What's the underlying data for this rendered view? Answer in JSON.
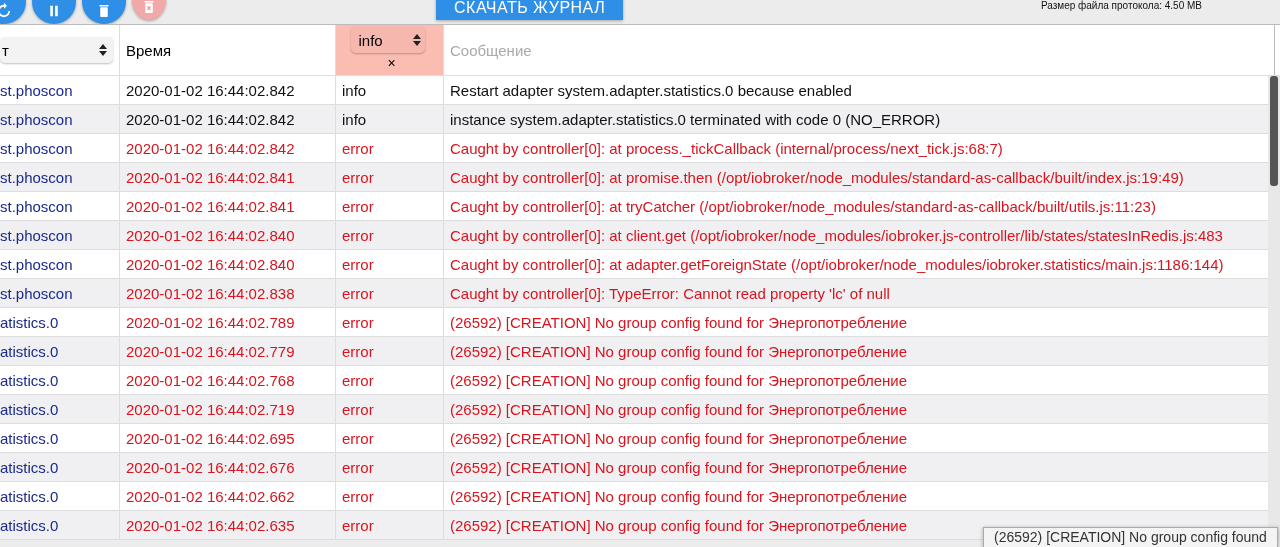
{
  "toolbar": {
    "buttons": [
      {
        "kind": "refresh"
      },
      {
        "kind": "pause"
      },
      {
        "kind": "delete"
      },
      {
        "kind": "clear",
        "disabled": true
      }
    ],
    "download_label": "СКАЧАТЬ ЖУРНАЛ",
    "file_size": "Размер файла протокола: 4.50 MB"
  },
  "table": {
    "columns": [
      {
        "kind": "select",
        "value": "т"
      },
      {
        "kind": "label",
        "label": "Время"
      },
      {
        "kind": "level",
        "value": "info",
        "clear": "×"
      },
      {
        "kind": "search",
        "placeholder": "Сообщение"
      }
    ],
    "rows": [
      {
        "source": "st.phoscon",
        "time": "2020-01-02 16:44:02.842",
        "level": "info",
        "kind": "info",
        "message": "Restart adapter system.adapter.statistics.0 because enabled"
      },
      {
        "source": "st.phoscon",
        "time": "2020-01-02 16:44:02.842",
        "level": "info",
        "kind": "info",
        "message": "instance system.adapter.statistics.0 terminated with code 0 (NO_ERROR)"
      },
      {
        "source": "st.phoscon",
        "time": "2020-01-02 16:44:02.842",
        "level": "error",
        "kind": "error",
        "message": "Caught by controller[0]: at process._tickCallback (internal/process/next_tick.js:68:7)"
      },
      {
        "source": "st.phoscon",
        "time": "2020-01-02 16:44:02.841",
        "level": "error",
        "kind": "error",
        "message": "Caught by controller[0]: at promise.then (/opt/iobroker/node_modules/standard-as-callback/built/index.js:19:49)"
      },
      {
        "source": "st.phoscon",
        "time": "2020-01-02 16:44:02.841",
        "level": "error",
        "kind": "error",
        "message": "Caught by controller[0]: at tryCatcher (/opt/iobroker/node_modules/standard-as-callback/built/utils.js:11:23)"
      },
      {
        "source": "st.phoscon",
        "time": "2020-01-02 16:44:02.840",
        "level": "error",
        "kind": "error",
        "message": "Caught by controller[0]: at client.get (/opt/iobroker/node_modules/iobroker.js-controller/lib/states/statesInRedis.js:483"
      },
      {
        "source": "st.phoscon",
        "time": "2020-01-02 16:44:02.840",
        "level": "error",
        "kind": "error",
        "message": "Caught by controller[0]: at adapter.getForeignState (/opt/iobroker/node_modules/iobroker.statistics/main.js:1186:144)"
      },
      {
        "source": "st.phoscon",
        "time": "2020-01-02 16:44:02.838",
        "level": "error",
        "kind": "error",
        "message": "Caught by controller[0]: TypeError: Cannot read property 'lc' of null"
      },
      {
        "source": "atistics.0",
        "time": "2020-01-02 16:44:02.789",
        "level": "error",
        "kind": "error",
        "message": "(26592) [CREATION] No group config found for Энергопотребление"
      },
      {
        "source": "atistics.0",
        "time": "2020-01-02 16:44:02.779",
        "level": "error",
        "kind": "error",
        "message": "(26592) [CREATION] No group config found for Энергопотребление"
      },
      {
        "source": "atistics.0",
        "time": "2020-01-02 16:44:02.768",
        "level": "error",
        "kind": "error",
        "message": "(26592) [CREATION] No group config found for Энергопотребление"
      },
      {
        "source": "atistics.0",
        "time": "2020-01-02 16:44:02.719",
        "level": "error",
        "kind": "error",
        "message": "(26592) [CREATION] No group config found for Энергопотребление"
      },
      {
        "source": "atistics.0",
        "time": "2020-01-02 16:44:02.695",
        "level": "error",
        "kind": "error",
        "message": "(26592) [CREATION] No group config found for Энергопотребление"
      },
      {
        "source": "atistics.0",
        "time": "2020-01-02 16:44:02.676",
        "level": "error",
        "kind": "error",
        "message": "(26592) [CREATION] No group config found for Энергопотребление"
      },
      {
        "source": "atistics.0",
        "time": "2020-01-02 16:44:02.662",
        "level": "error",
        "kind": "error",
        "message": "(26592) [CREATION] No group config found for Энергопотребление"
      },
      {
        "source": "atistics.0",
        "time": "2020-01-02 16:44:02.635",
        "level": "error",
        "kind": "error",
        "message": "(26592) [CREATION] No group config found for Энергопотребление"
      }
    ]
  },
  "tooltip": "(26592) [CREATION] No group config found"
}
